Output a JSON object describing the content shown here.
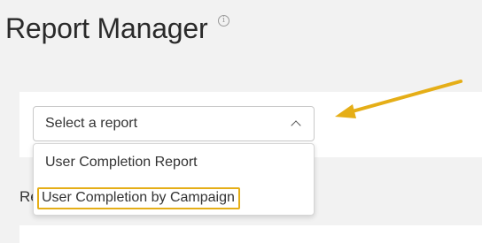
{
  "header": {
    "title": "Report Manager",
    "info_icon": "info-icon"
  },
  "report_select": {
    "value": "Select a report",
    "icon": "chevron-up-icon"
  },
  "behind_label": "Re",
  "dropdown": {
    "options": [
      {
        "label": "User Completion Report"
      },
      {
        "label": "User Completion by Campaign",
        "highlighted": true
      }
    ]
  },
  "annotation": {
    "arrow_color": "#e5ae17",
    "highlight_color": "#e5ae17"
  }
}
